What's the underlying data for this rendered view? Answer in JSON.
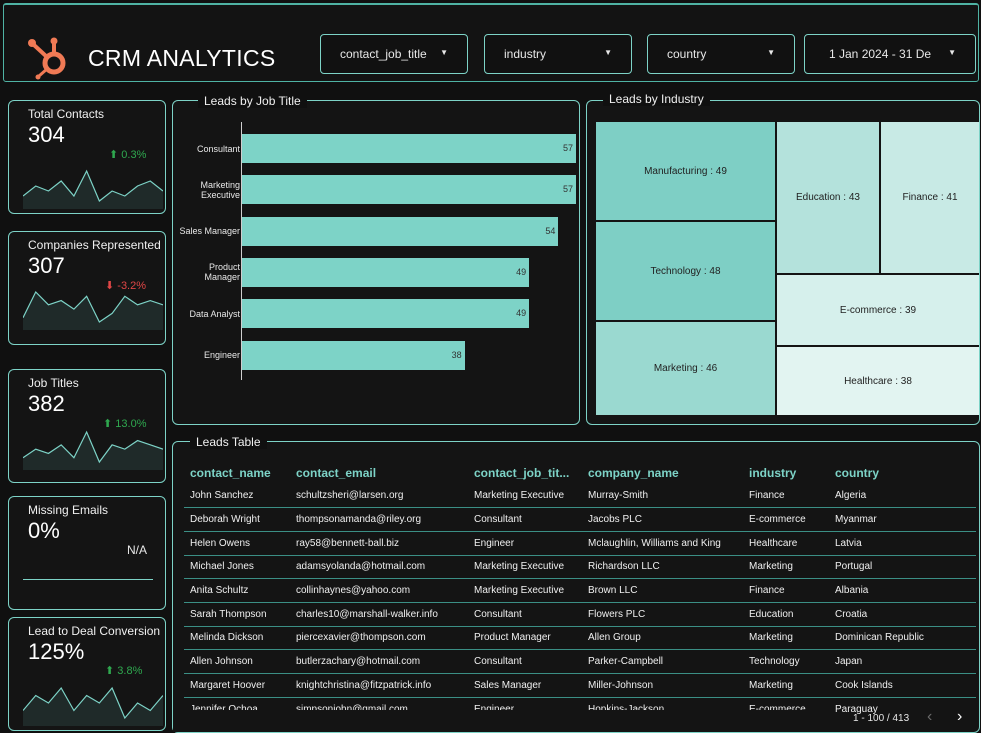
{
  "header": {
    "title": "CRM ANALYTICS",
    "logo_icon": "hubspot-sprocket-icon",
    "accent": "#f07a55",
    "filters": [
      {
        "label": "contact_job_title"
      },
      {
        "label": "industry"
      },
      {
        "label": "country"
      },
      {
        "label": "1 Jan 2024 - 31 De"
      }
    ]
  },
  "kpis": [
    {
      "label": "Total Contacts",
      "value": "304",
      "delta": "0.3%",
      "direction": "up",
      "trend": [
        4,
        6,
        5,
        7,
        4,
        9,
        3,
        5,
        4,
        6,
        7,
        5
      ]
    },
    {
      "label": "Companies Represented",
      "value": "307",
      "delta": "-3.2%",
      "direction": "down",
      "trend": [
        3,
        9,
        6,
        7,
        5,
        8,
        2,
        4,
        8,
        6,
        7,
        6
      ]
    },
    {
      "label": "Job Titles",
      "value": "382",
      "delta": "13.0%",
      "direction": "up",
      "trend": [
        3,
        5,
        4,
        6,
        3,
        9,
        2,
        6,
        5,
        7,
        6,
        5
      ]
    },
    {
      "label": "Missing Emails",
      "value": "0%",
      "delta": "N/A",
      "direction": "none",
      "trend": []
    },
    {
      "label": "Lead to Deal Conversion",
      "value": "125%",
      "delta": "3.8%",
      "direction": "up",
      "trend": [
        4,
        6,
        5,
        7,
        4,
        6,
        5,
        7,
        3,
        5,
        4,
        6
      ]
    }
  ],
  "job_title_chart": {
    "title": "Leads by Job Title",
    "color": "#7dd3c7",
    "chart_data": {
      "type": "bar",
      "orientation": "horizontal",
      "categories": [
        "Consultant",
        "Marketing Executive",
        "Sales Manager",
        "Product Manager",
        "Data Analyst",
        "Engineer"
      ],
      "category_lines": [
        [
          "Consultant"
        ],
        [
          "Marketing",
          "Executive"
        ],
        [
          "Sales Manager"
        ],
        [
          "Product",
          "Manager"
        ],
        [
          "Data Analyst"
        ],
        [
          "Engineer"
        ]
      ],
      "values": [
        57,
        57,
        54,
        49,
        49,
        38
      ],
      "xlim": [
        0,
        57
      ]
    }
  },
  "industry_chart": {
    "title": "Leads by Industry",
    "chart_data": {
      "type": "treemap",
      "items": [
        {
          "name": "Manufacturing",
          "value": 49,
          "color": "#7ecfc5"
        },
        {
          "name": "Technology",
          "value": 48,
          "color": "#7ecfc5"
        },
        {
          "name": "Marketing",
          "value": 46,
          "color": "#9ad9d0"
        },
        {
          "name": "Education",
          "value": 43,
          "color": "#b4e2dc"
        },
        {
          "name": "Finance",
          "value": 41,
          "color": "#c8eae5"
        },
        {
          "name": "E-commerce",
          "value": 39,
          "color": "#d6f0ec"
        },
        {
          "name": "Healthcare",
          "value": 38,
          "color": "#e2f4f1"
        }
      ]
    }
  },
  "leads_table": {
    "title": "Leads Table",
    "columns": [
      "contact_name",
      "contact_email",
      "contact_job_tit...",
      "company_name",
      "industry",
      "country"
    ],
    "rows": [
      [
        "John Sanchez",
        "schultzsheri@larsen.org",
        "Marketing Executive",
        "Murray-Smith",
        "Finance",
        "Algeria"
      ],
      [
        "Deborah Wright",
        "thompsonamanda@riley.org",
        "Consultant",
        "Jacobs PLC",
        "E-commerce",
        "Myanmar"
      ],
      [
        "Helen Owens",
        "ray58@bennett-ball.biz",
        "Engineer",
        "Mclaughlin, Williams and King",
        "Healthcare",
        "Latvia"
      ],
      [
        "Michael Jones",
        "adamsyolanda@hotmail.com",
        "Marketing Executive",
        "Richardson LLC",
        "Marketing",
        "Portugal"
      ],
      [
        "Anita Schultz",
        "collinhaynes@yahoo.com",
        "Marketing Executive",
        "Brown LLC",
        "Finance",
        "Albania"
      ],
      [
        "Sarah Thompson",
        "charles10@marshall-walker.info",
        "Consultant",
        "Flowers PLC",
        "Education",
        "Croatia"
      ],
      [
        "Melinda Dickson",
        "piercexavier@thompson.com",
        "Product Manager",
        "Allen Group",
        "Marketing",
        "Dominican Republic"
      ],
      [
        "Allen Johnson",
        "butlerzachary@hotmail.com",
        "Consultant",
        "Parker-Campbell",
        "Technology",
        "Japan"
      ],
      [
        "Margaret Hoover",
        "knightchristina@fitzpatrick.info",
        "Sales Manager",
        "Miller-Johnson",
        "Marketing",
        "Cook Islands"
      ],
      [
        "Jennifer Ochoa",
        "simpsonjohn@gmail.com",
        "Engineer",
        "Hopkins-Jackson",
        "E-commerce",
        "Paraguay"
      ]
    ],
    "pagination": "1 - 100 / 413"
  },
  "icons": {
    "prev": "chevron-left-icon",
    "next": "chevron-right-icon",
    "up": "arrow-up-icon",
    "down": "arrow-down-icon",
    "caret": "caret-down-icon"
  }
}
